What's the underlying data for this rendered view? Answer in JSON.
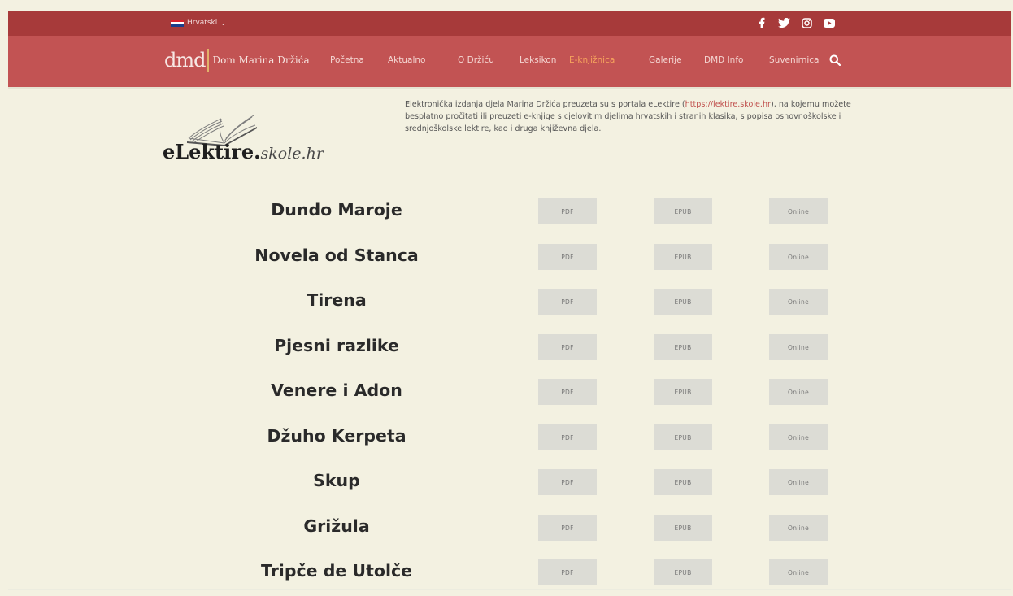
{
  "topbar": {
    "language": "Hrvatski",
    "flag_colors": [
      "#d8202b",
      "#ffffff",
      "#1a3e8c"
    ],
    "social_icons": [
      "facebook-icon",
      "twitter-icon",
      "instagram-icon",
      "youtube-icon"
    ]
  },
  "header": {
    "logo_abbr": "dmd",
    "logo_name": "Dom Marina Držića",
    "nav": [
      {
        "label": "Početna"
      },
      {
        "label": "Aktualno"
      },
      {
        "label": "O Držiću"
      },
      {
        "label": "Leksikon"
      },
      {
        "label": "E-knjižnica",
        "active": true
      },
      {
        "label": "Galerije"
      },
      {
        "label": "DMD Info"
      },
      {
        "label": "Suvenirnica"
      }
    ]
  },
  "intro": {
    "brand_main": "eLektire.",
    "brand_sub": "skole.hr",
    "text_before": "Elektronička izdanja djela Marina Držića preuzeta su s portala eLektire (",
    "link": "https://lektire.skole.hr",
    "text_after": "), na kojemu možete besplatno pročitati ili preuzeti e-knjige s cjelovitim djelima hrvatskih i stranih klasika, s popisa osnovnoškolske i srednjoškolske lektire, kao i druga književna djela."
  },
  "buttons": {
    "pdf": "PDF",
    "epub": "EPUB",
    "online": "Online"
  },
  "books": [
    {
      "title": "Dundo Maroje"
    },
    {
      "title": "Novela od Stanca"
    },
    {
      "title": "Tirena"
    },
    {
      "title": "Pjesni razlike"
    },
    {
      "title": "Venere i Adon"
    },
    {
      "title": "Džuho Kerpeta"
    },
    {
      "title": "Skup"
    },
    {
      "title": "Grižula"
    },
    {
      "title": "Tripče de Utolče"
    }
  ],
  "colors": {
    "topbar": "#a73a3a",
    "navbar": "#c25353",
    "active_nav": "#f6a35d",
    "background": "#f3f1e1",
    "button": "#dcdcd5",
    "link": "#c0504d"
  }
}
